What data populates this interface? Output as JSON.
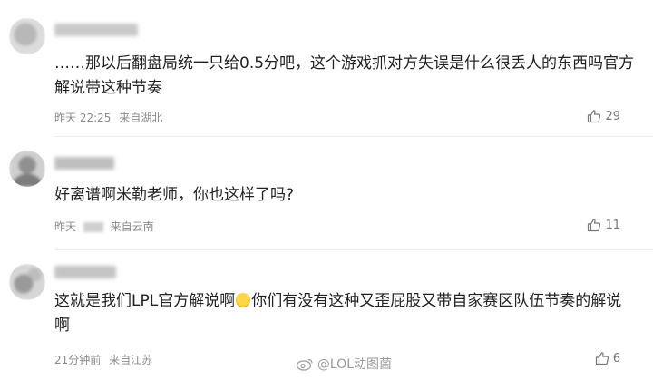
{
  "comments": [
    {
      "content": "……那以后翻盘局统一只给0.5分吧，这个游戏抓对方失误是什么很丢人的东西吗官方解说带这种节奏",
      "time": "昨天 22:25",
      "location": "来自湖北",
      "likes": "29"
    },
    {
      "content": "好离谱啊米勒老师，你也这样了吗?",
      "time": "昨天",
      "location": "来自云南",
      "likes": "11"
    },
    {
      "content_a": "这就是我们LPL官方解说啊",
      "content_b": "你们有没有这种又歪屁股又带自家赛区队伍节奏的解说啊",
      "time": "21分钟前",
      "location": "来自江苏",
      "likes": "6"
    }
  ],
  "watermark": "@LOL动图菌",
  "icons": {
    "like": "thumbs-up-icon",
    "emoji": "smile-emoji-icon",
    "watermark": "weibo-logo-icon"
  }
}
